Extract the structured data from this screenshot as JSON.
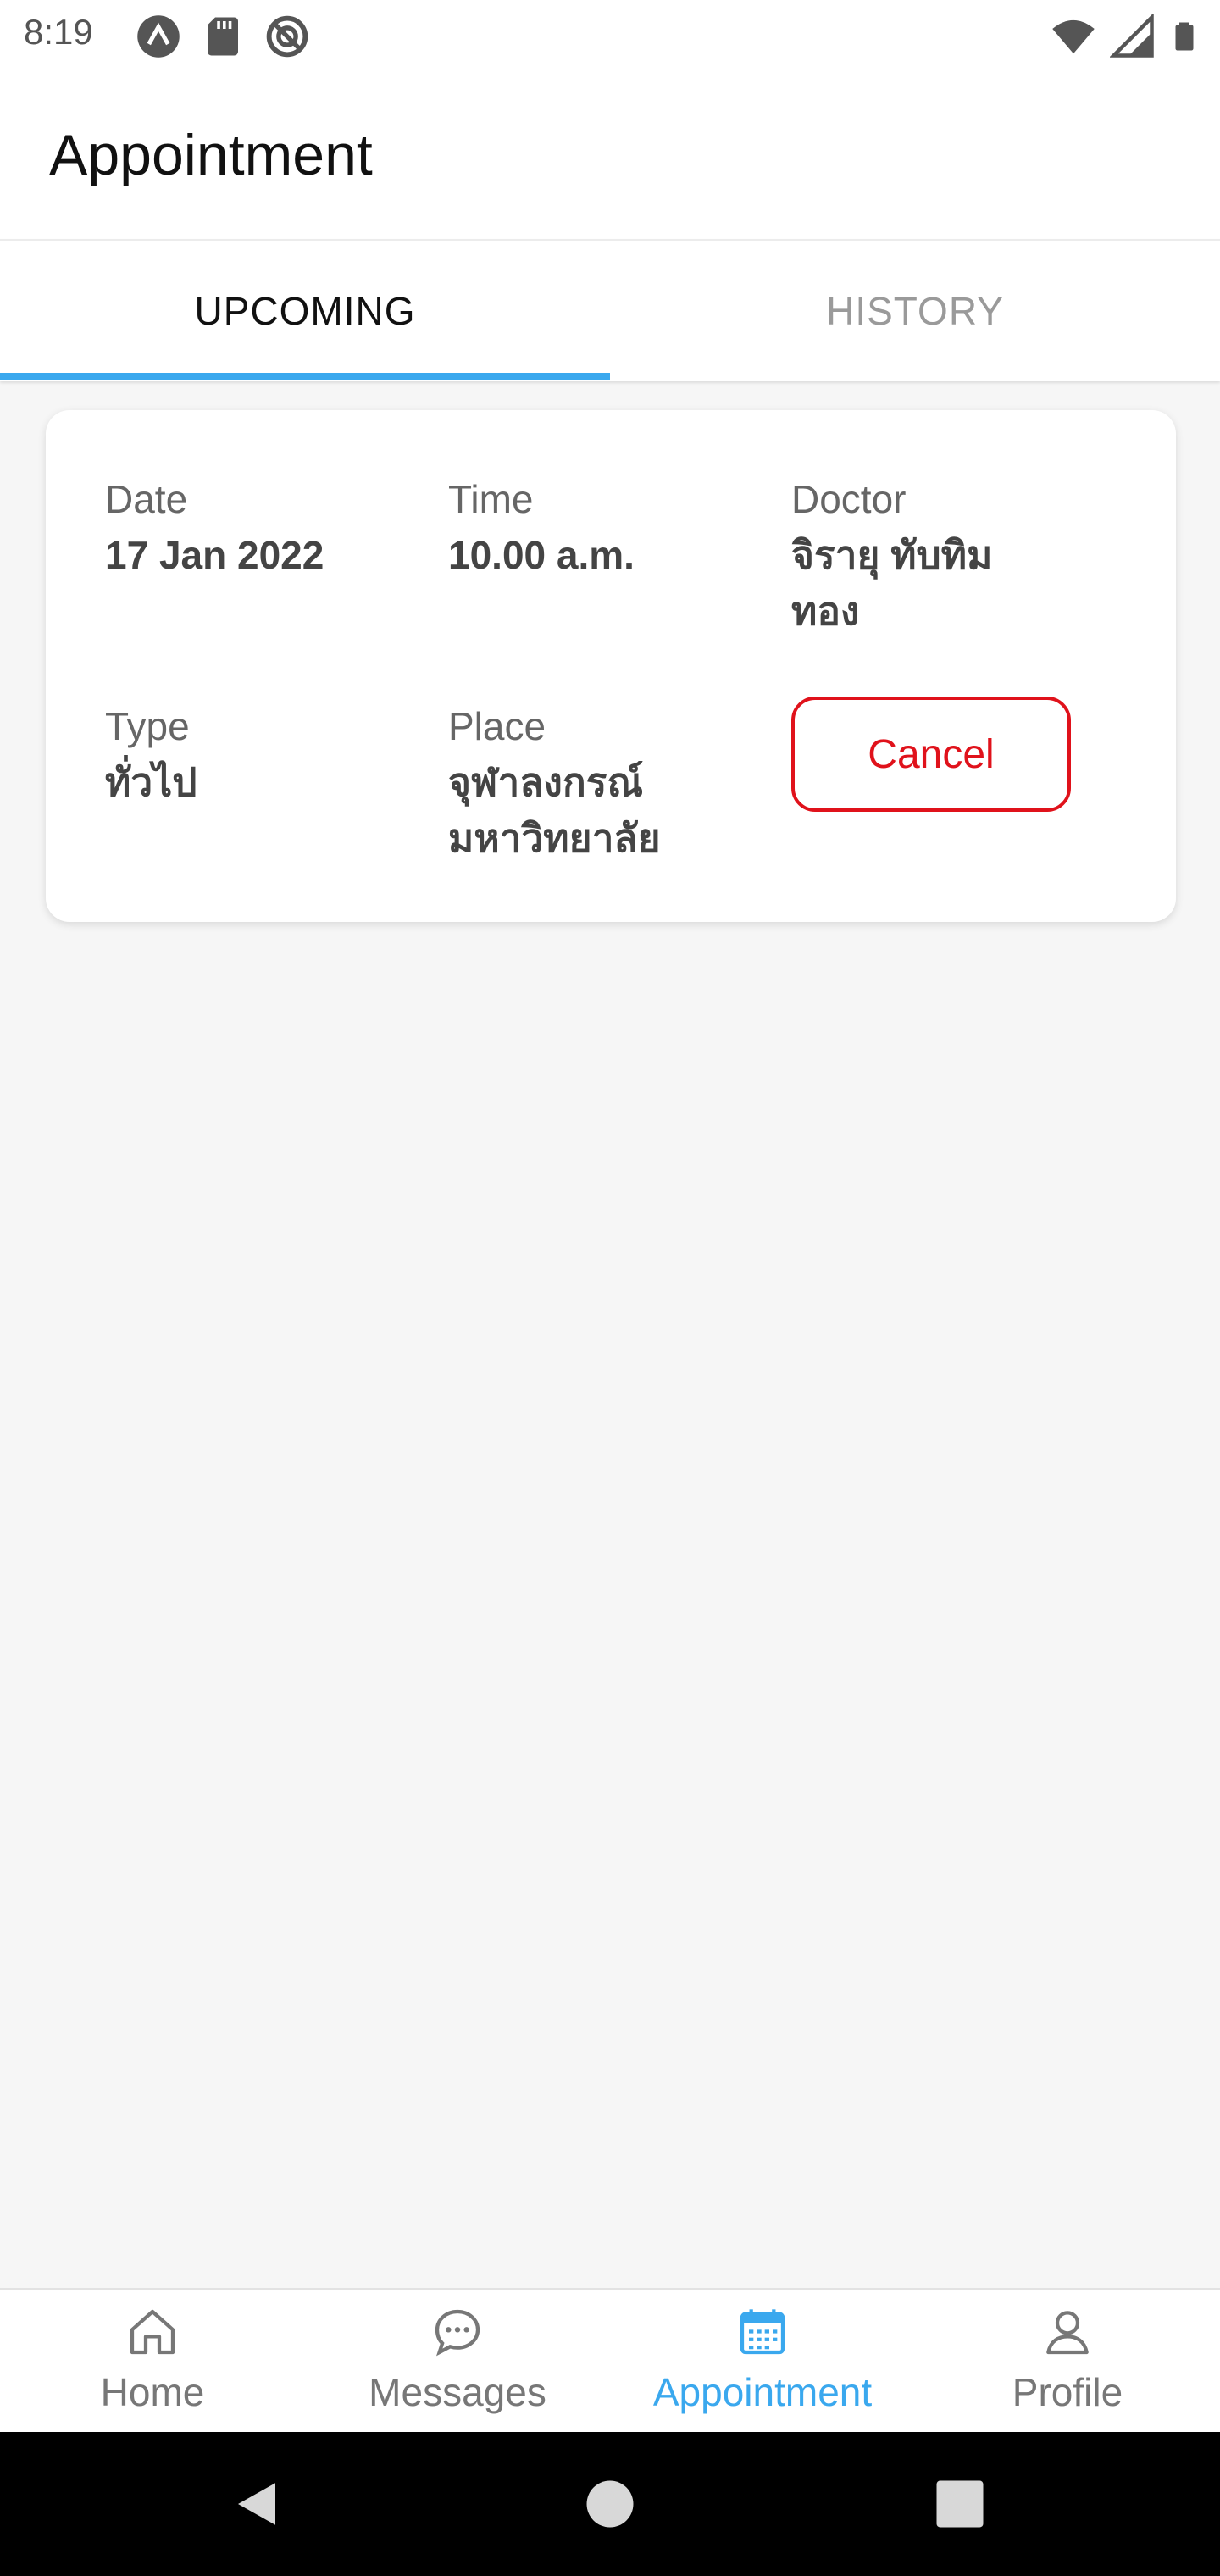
{
  "status_bar": {
    "time": "8:19",
    "left_icons": [
      "app-icon",
      "sd-card-icon",
      "sync-icon"
    ],
    "right_icons": [
      "wifi-icon",
      "signal-icon",
      "battery-icon"
    ]
  },
  "header": {
    "title": "Appointment"
  },
  "tabs": [
    {
      "label": "UPCOMING",
      "active": true
    },
    {
      "label": "HISTORY",
      "active": false
    }
  ],
  "appointment": {
    "date_label": "Date",
    "date_value": "17 Jan 2022",
    "time_label": "Time",
    "time_value": "10.00 a.m.",
    "doctor_label": "Doctor",
    "doctor_value_line1": "จิรายุ ทับทิม",
    "doctor_value_line2": "ทอง",
    "type_label": "Type",
    "type_value": "ทั่วไป",
    "place_label": "Place",
    "place_value_line1": "จุฬาลงกรณ์",
    "place_value_line2": "มหาวิทยาลัย",
    "cancel_label": "Cancel"
  },
  "bottom_nav": [
    {
      "label": "Home",
      "icon": "home-icon",
      "active": false
    },
    {
      "label": "Messages",
      "icon": "chat-icon",
      "active": false
    },
    {
      "label": "Appointment",
      "icon": "calendar-icon",
      "active": true
    },
    {
      "label": "Profile",
      "icon": "person-icon",
      "active": false
    }
  ],
  "colors": {
    "accent": "#3aa8ee",
    "cancel": "#e0121b",
    "background": "#f6f6f6"
  }
}
